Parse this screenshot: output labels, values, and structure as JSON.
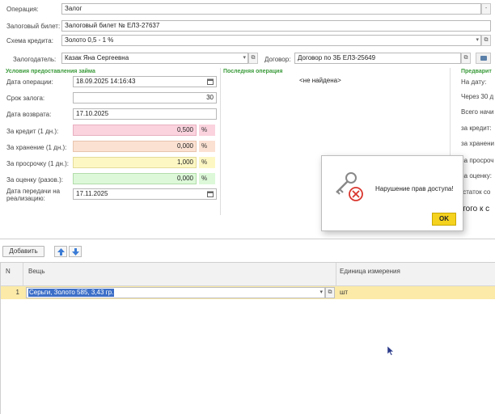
{
  "form": {
    "operation_label": "Операция:",
    "operation_value": "Залог",
    "ticket_label": "Залоговый билет:",
    "ticket_value": "Залоговый билет № ЕЛЗ-27637",
    "scheme_label": "Схема кредита:",
    "scheme_value": "Золото 0,5 - 1 %",
    "pledger_label": "Залогодатель:",
    "pledger_value": "Казак Яна Сергеевна",
    "contract_label": "Договор:",
    "contract_value": "Договор по ЗБ ЕЛЗ-25649"
  },
  "conditions": {
    "title": "Условия предоставления займа",
    "op_date_label": "Дата операции:",
    "op_date_value": "18.09.2025 14:16:43",
    "term_label": "Срок залога:",
    "term_value": "30",
    "return_date_label": "Дата возврата:",
    "return_date_value": "17.10.2025",
    "credit_label": "За кредит (1 дн.):",
    "credit_value": "0,500",
    "storage_label": "За хранение (1 дн.):",
    "storage_value": "0,000",
    "overdue_label": "За просрочку (1 дн.):",
    "overdue_value": "1,000",
    "appraisal_label": "За оценку (разов.):",
    "appraisal_value": "0,000",
    "pct": "%",
    "realization_label_1": "Дата передачи на",
    "realization_label_2": "реализацию:",
    "realization_value": "17.11.2025"
  },
  "last_operation": {
    "title": "Последняя операция",
    "value": "<не найдена>"
  },
  "preview": {
    "title": "Предварит",
    "on_date": "На дату:",
    "after30": "Через 30 д",
    "total_accrued": "Всего начи",
    "for_credit": "за кредит:",
    "for_storage": "за хранени",
    "for_overdue": "за просроч",
    "for_appraisal": "за оценку:",
    "remainder": "Остаток со",
    "total_due": "Итого к с"
  },
  "dialog": {
    "message": "Нарушение прав доступа!",
    "ok_label": "OK"
  },
  "table": {
    "add_label": "Добавить",
    "col_n": "N",
    "col_item": "Вещь",
    "col_unit": "Единица измерения",
    "rows": [
      {
        "n": "1",
        "item": "Серьги, Золото 585, 3,43 гр.",
        "unit": "шт"
      }
    ]
  }
}
